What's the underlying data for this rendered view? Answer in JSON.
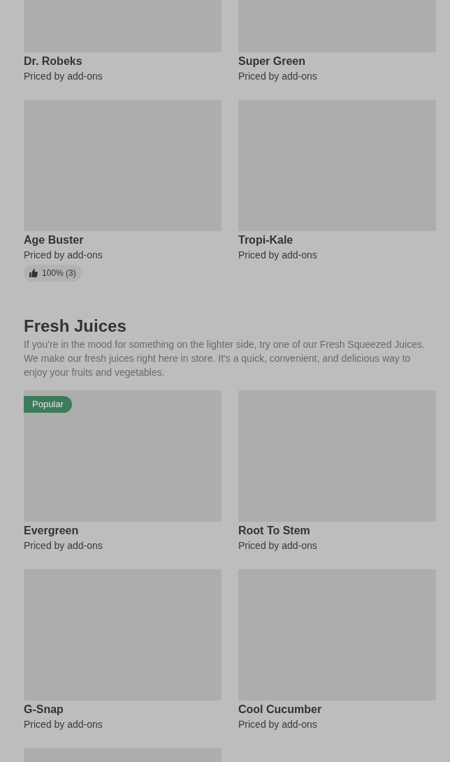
{
  "sections": [
    {
      "items": [
        {
          "name": "Dr. Robeks",
          "price": "Priced by add-ons",
          "image": {
            "kind": "placeholder"
          }
        },
        {
          "name": "Super Green",
          "price": "Priced by add-ons",
          "image": {
            "kind": "placeholder"
          }
        },
        {
          "name": "Age Buster",
          "price": "Priced by add-ons",
          "image": {
            "kind": "placeholder"
          },
          "rating": "100% (3)"
        },
        {
          "name": "Tropi-Kale",
          "price": "Priced by add-ons",
          "image": {
            "kind": "placeholder"
          }
        }
      ]
    },
    {
      "title": "Fresh Juices",
      "description": "If you're in the mood for something on the lighter side, try one of our Fresh Squeezed Juices. We make our fresh juices right here in store. It's a quick, convenient, and delicious way to enjoy your fruits and vegetables.",
      "items": [
        {
          "name": "Evergreen",
          "price": "Priced by add-ons",
          "image": {
            "kind": "placeholder"
          },
          "badge": "Popular"
        },
        {
          "name": "Root To Stem",
          "price": "Priced by add-ons",
          "image": {
            "kind": "placeholder"
          }
        },
        {
          "name": "G-Snap",
          "price": "Priced by add-ons",
          "image": {
            "kind": "placeholder"
          }
        },
        {
          "name": "Cool Cucumber",
          "price": "Priced by add-ons",
          "image": {
            "kind": "placeholder"
          }
        },
        {
          "image": {
            "kind": "placeholder"
          }
        }
      ]
    }
  ]
}
